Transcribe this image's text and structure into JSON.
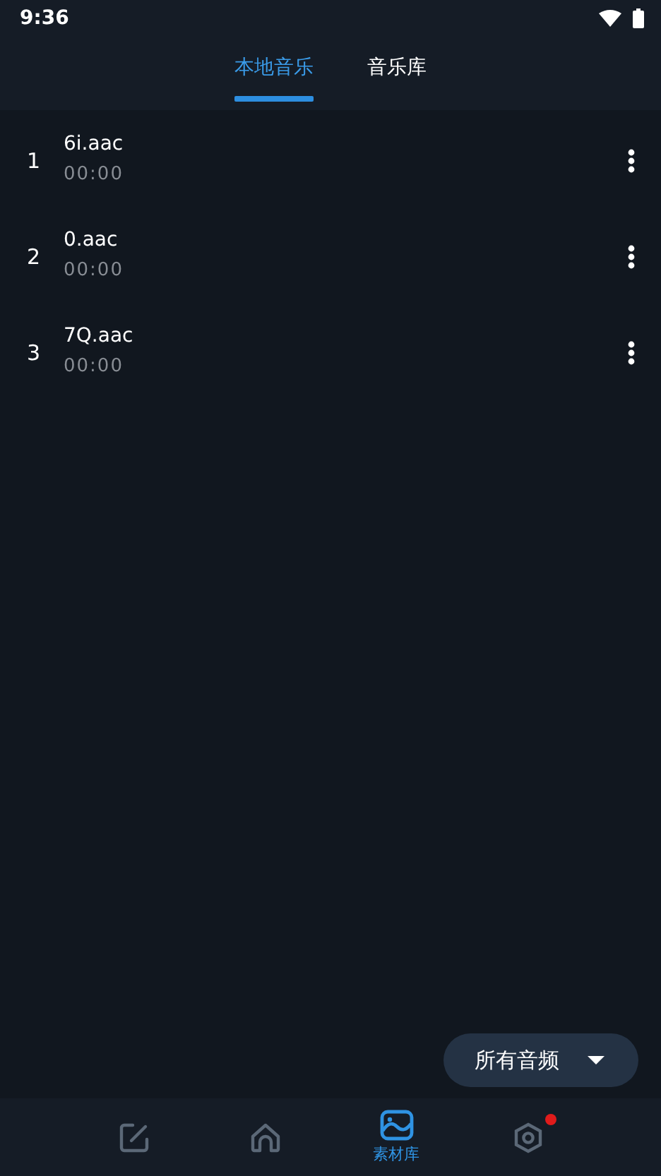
{
  "status_bar": {
    "time": "9:36"
  },
  "tabs": [
    {
      "label": "本地音乐",
      "selected": true
    },
    {
      "label": "音乐库",
      "selected": false
    }
  ],
  "tracks": [
    {
      "index": "1",
      "name": "6i.aac",
      "duration": "00:00"
    },
    {
      "index": "2",
      "name": "0.aac",
      "duration": "00:00"
    },
    {
      "index": "3",
      "name": "7Q.aac",
      "duration": "00:00"
    }
  ],
  "filter_button": {
    "label": "所有音频"
  },
  "bottom_nav": [
    {
      "kind": "edit",
      "selected": false,
      "badge": false
    },
    {
      "kind": "home",
      "selected": false,
      "badge": false
    },
    {
      "kind": "gallery",
      "label": "素材库",
      "selected": true,
      "badge": false
    },
    {
      "kind": "settings",
      "selected": false,
      "badge": true
    }
  ]
}
